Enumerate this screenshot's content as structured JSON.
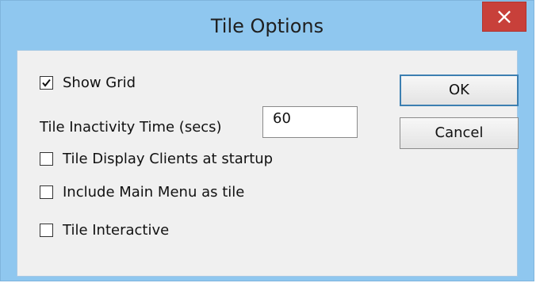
{
  "window": {
    "title": "Tile Options",
    "close_glyph": "×"
  },
  "options": {
    "show_grid": {
      "label": "Show Grid",
      "checked": true
    },
    "inactivity": {
      "label": "Tile Inactivity Time (secs)",
      "value": "60"
    },
    "display_clients": {
      "label": "Tile Display Clients at startup",
      "checked": false
    },
    "include_main_menu": {
      "label": "Include Main Menu as tile",
      "checked": false
    },
    "interactive": {
      "label": "Tile Interactive",
      "checked": false
    }
  },
  "buttons": {
    "ok": "OK",
    "cancel": "Cancel"
  },
  "icons": {
    "close": "close-icon",
    "check": "checkmark-icon"
  },
  "colors": {
    "title_bar": "#8fc7ef",
    "close_button": "#c8403a",
    "dialog_body": "#f0f0f0",
    "default_button_border": "#3c7fb1"
  }
}
